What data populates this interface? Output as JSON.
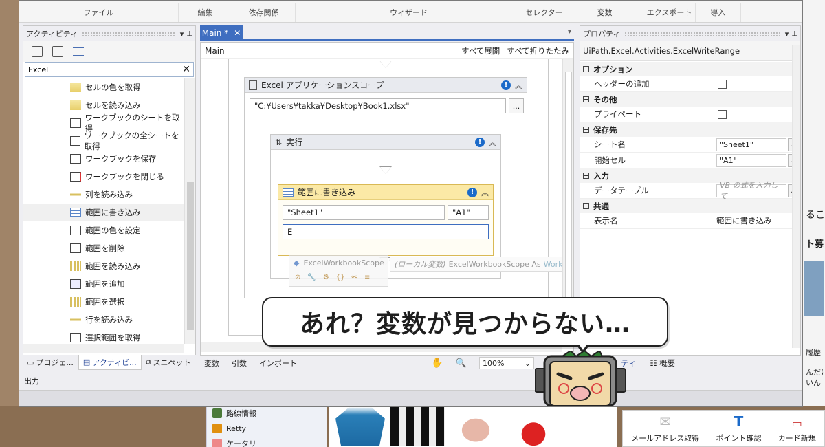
{
  "ribbon": {
    "groups": [
      "ファイル",
      "編集",
      "依存関係",
      "ウィザード",
      "セレクター",
      "変数",
      "エクスポート",
      "導入"
    ]
  },
  "activities_panel": {
    "title": "アクティビティ",
    "search_value": "Excel",
    "items": [
      {
        "label": "セルの色を取得"
      },
      {
        "label": "セルを読み込み"
      },
      {
        "label": "ワークブックのシートを取得"
      },
      {
        "label": "ワークブックの全シートを取得"
      },
      {
        "label": "ワークブックを保存"
      },
      {
        "label": "ワークブックを閉じる"
      },
      {
        "label": "列を読み込み"
      },
      {
        "label": "範囲に書き込み"
      },
      {
        "label": "範囲の色を設定"
      },
      {
        "label": "範囲を削除"
      },
      {
        "label": "範囲を読み込み"
      },
      {
        "label": "範囲を追加"
      },
      {
        "label": "範囲を選択"
      },
      {
        "label": "行を読み込み"
      },
      {
        "label": "選択範囲を取得"
      }
    ],
    "bottom_tabs": [
      "プロジェ...",
      "アクティビ...",
      "スニペット"
    ],
    "output_label": "出力"
  },
  "designer": {
    "tab_label": "Main *",
    "breadcrumb": "Main",
    "expand_all": "すべて展開",
    "collapse_all": "すべて折りたたみ",
    "excel_scope": {
      "title": "Excel アプリケーションスコープ",
      "path_value": "\"C:¥Users¥takka¥Desktop¥Book1.xlsx\""
    },
    "execute": {
      "title": "実行"
    },
    "write_range": {
      "title": "範囲に書き込み",
      "sheet_value": "\"Sheet1\"",
      "cell_value": "\"A1\"",
      "datatable_value": "E"
    },
    "autocomplete": {
      "item": "ExcelWorkbookScope",
      "tooltip_prefix": "(ローカル変数)",
      "tooltip_name": "ExcelWorkbookScope As",
      "tooltip_type": "WorkbookApplication"
    },
    "bottom": {
      "variables": "変数",
      "arguments": "引数",
      "imports": "インポート",
      "zoom": "100%"
    }
  },
  "properties_panel": {
    "title": "プロパティ",
    "type_name": "UiPath.Excel.Activities.ExcelWriteRange",
    "categories": [
      {
        "name": "オプション",
        "props": [
          {
            "name": "ヘッダーの追加",
            "kind": "checkbox"
          }
        ]
      },
      {
        "name": "その他",
        "props": [
          {
            "name": "プライベート",
            "kind": "checkbox"
          }
        ]
      },
      {
        "name": "保存先",
        "props": [
          {
            "name": "シート名",
            "value": "\"Sheet1\""
          },
          {
            "name": "開始セル",
            "value": "\"A1\""
          }
        ]
      },
      {
        "name": "入力",
        "props": [
          {
            "name": "データテーブル",
            "placeholder": "VB の式を入力して"
          }
        ]
      },
      {
        "name": "共通",
        "props": [
          {
            "name": "表示名",
            "value": "範囲に書き込み"
          }
        ]
      }
    ],
    "bottom_tabs": [
      "ティ",
      "概要"
    ]
  },
  "bubble_text": "あれ？変数が見つからない…",
  "background": {
    "left_items": [
      "路線情報",
      "Retty",
      "ケータリ"
    ],
    "right_tiles": [
      "メールアドレス取得",
      "ポイント確認",
      "カード新規"
    ],
    "side_texts": [
      "るこ",
      "ト募",
      "履歴",
      "んだけ",
      "いん"
    ]
  }
}
